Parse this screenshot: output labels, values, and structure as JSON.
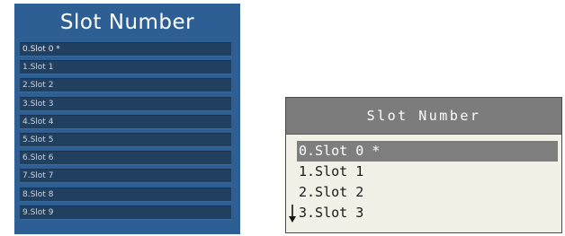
{
  "blue_menu": {
    "title": "Slot Number",
    "items": [
      {
        "label": "0.Slot 0 *",
        "selected": true
      },
      {
        "label": "1.Slot 1",
        "selected": false
      },
      {
        "label": "2.Slot 2",
        "selected": false
      },
      {
        "label": "3.Slot 3",
        "selected": false
      },
      {
        "label": "4.Slot 4",
        "selected": false
      },
      {
        "label": "5.Slot 5",
        "selected": false
      },
      {
        "label": "6.Slot 6",
        "selected": false
      },
      {
        "label": "7.Slot 7",
        "selected": false
      },
      {
        "label": "8.Slot 8",
        "selected": false
      },
      {
        "label": "9.Slot 9",
        "selected": false
      }
    ],
    "colors": {
      "panel": "#2d5f94",
      "item": "#213f5f",
      "text": "#c9d6e4"
    }
  },
  "lcd_menu": {
    "title": "Slot Number",
    "items": [
      {
        "label": "0.Slot 0 *",
        "selected": true
      },
      {
        "label": "1.Slot 1",
        "selected": false
      },
      {
        "label": "2.Slot 2",
        "selected": false
      },
      {
        "label": "3.Slot 3",
        "selected": false
      }
    ],
    "scroll_indicator_icon": "arrow-down-icon",
    "colors": {
      "header": "#7c7c7c",
      "background": "#f1f1e7",
      "selection": "#7e7e7e"
    }
  }
}
